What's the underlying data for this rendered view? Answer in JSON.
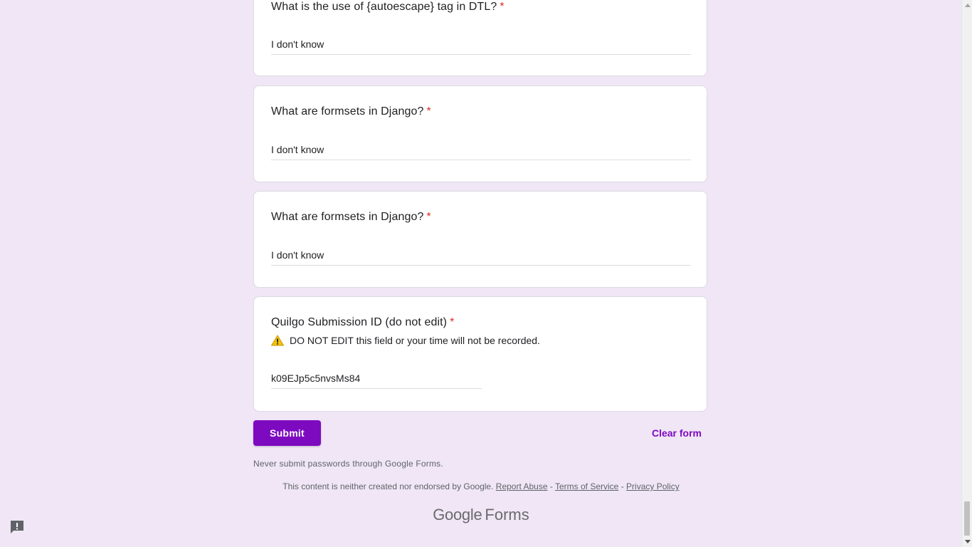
{
  "questions": [
    {
      "title": "What is the use of {autoescape} tag in DTL?",
      "required_mark": "*",
      "answer": "I don't know"
    },
    {
      "title": "What are formsets in Django?",
      "required_mark": "*",
      "answer": "I don't know"
    },
    {
      "title": "What are formsets in Django?",
      "required_mark": "*",
      "answer": "I don't know"
    },
    {
      "title": "Quilgo Submission ID (do not edit)",
      "required_mark": "*",
      "warning_icon": "warning-icon",
      "description": "DO NOT EDIT this field or your time will not be recorded.",
      "answer": "k09EJp5c5nvsMs84"
    }
  ],
  "actions": {
    "submit_label": "Submit",
    "clear_label": "Clear form"
  },
  "footer": {
    "password_notice": "Never submit passwords through Google Forms.",
    "disclaimer": "This content is neither created nor endorsed by Google.",
    "report_abuse": "Report Abuse",
    "terms": "Terms of Service",
    "privacy": "Privacy Policy",
    "separator": "-",
    "brand_google": "Google",
    "brand_forms": "Forms"
  },
  "icons": {
    "report": "report-problem-icon",
    "scroll_up": "scroll-up-arrow-icon",
    "scroll_down": "scroll-down-arrow-icon"
  },
  "colors": {
    "background": "#f0e6f6",
    "accent": "#7e0ac0",
    "required": "#d93025"
  }
}
